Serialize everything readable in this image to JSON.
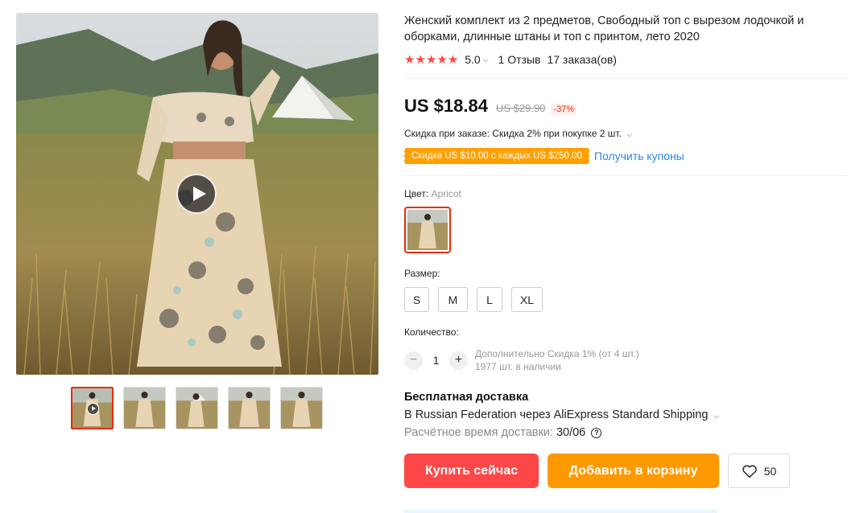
{
  "product": {
    "title": "Женский комплект из 2 предметов, Свободный топ с вырезом лодочкой и оборками, длинные штаны и топ с принтом, лето 2020",
    "rating": {
      "stars": "★★★★★",
      "value": "5.0",
      "reviews": "1 Отзыв",
      "orders": "17 заказа(ов)"
    },
    "price": {
      "current": "US $18.84",
      "old": "US $29.90",
      "discount": "-37%"
    },
    "order_discount": "Скидка при заказе: Скидка 2% при покупке 2 шт.",
    "coupon": {
      "tag": "Скидка US $10.00 с каждых US $250.00",
      "link": "Получить купоны"
    }
  },
  "options": {
    "color_label": "Цвет:",
    "color_value": "Apricot",
    "size_label": "Размер:",
    "sizes": [
      "S",
      "M",
      "L",
      "XL"
    ],
    "quantity_label": "Количество:",
    "quantity": "1",
    "minus": "−",
    "plus": "+",
    "quantity_discount": "Дополнительно Скидка 1% (от 4 шт.)",
    "stock": "1977 шт. в наличии"
  },
  "shipping": {
    "title": "Бесплатная доставка",
    "method": "В Russian Federation через AliExpress Standard Shipping",
    "estimate_label": "Расчётное время доставки:",
    "estimate_date": "30/06",
    "help": "?"
  },
  "actions": {
    "buy": "Купить сейчас",
    "cart": "Добавить в корзину",
    "wishlist_count": "50"
  },
  "colors": {
    "accent_red": "#ff4747",
    "accent_orange": "#ff9900",
    "coupon_orange": "#ffa000",
    "link_blue": "#2e86de"
  },
  "icons": {
    "play": "play-icon",
    "heart": "heart-icon",
    "chevron": "chevron-down-icon",
    "help": "question-circle-icon"
  }
}
